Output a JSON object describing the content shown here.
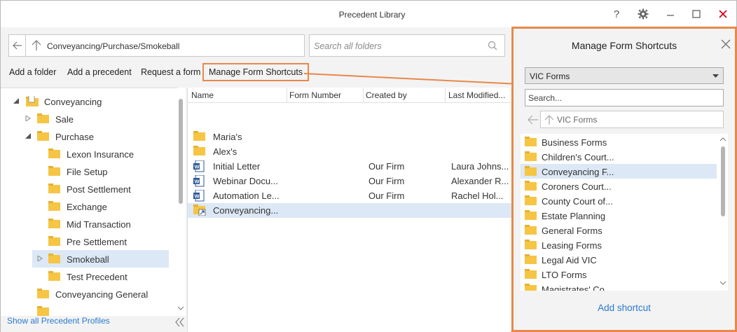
{
  "window": {
    "title": "Precedent Library",
    "help_icon": "question-icon",
    "settings_icon": "gear-icon",
    "minimize_icon": "minimize-icon",
    "maximize_icon": "maximize-icon",
    "close_icon": "close-icon",
    "close_color": "#d0021b"
  },
  "nav": {
    "path": "Conveyancing/Purchase/Smokeball",
    "search_placeholder": "Search all folders"
  },
  "actions": {
    "add_folder": "Add a folder",
    "add_precedent": "Add a precedent",
    "request_form": "Request a form",
    "manage_shortcuts": "Manage Form Shortcuts"
  },
  "tree": {
    "items": [
      {
        "label": "Conveyancing",
        "expanded": true,
        "icon": "document-folder-icon"
      },
      {
        "label": "Sale",
        "expanded": false
      },
      {
        "label": "Purchase",
        "expanded": true
      },
      {
        "label": "Lexon Insurance"
      },
      {
        "label": "File Setup"
      },
      {
        "label": "Post Settlement"
      },
      {
        "label": "Exchange"
      },
      {
        "label": "Mid Transaction"
      },
      {
        "label": "Pre Settlement"
      },
      {
        "label": "Smokeball",
        "expanded": false,
        "selected": true
      },
      {
        "label": "Test Precedent"
      },
      {
        "label": "Conveyancing General"
      }
    ]
  },
  "footer": {
    "show_all": "Show all Precedent Profiles"
  },
  "list": {
    "columns": [
      "Name",
      "Form Number",
      "Created by",
      "Last Modified..."
    ],
    "rows": [
      {
        "name": "Maria's",
        "form_number": "",
        "created_by": "",
        "last_modified": "",
        "icon": "folder-icon"
      },
      {
        "name": "Alex's",
        "form_number": "",
        "created_by": "",
        "last_modified": "",
        "icon": "folder-icon"
      },
      {
        "name": "Initial Letter",
        "form_number": "",
        "created_by": "Our Firm",
        "last_modified": "Laura Johns...",
        "icon": "word-doc-icon"
      },
      {
        "name": "Webinar Docu...",
        "form_number": "",
        "created_by": "Our Firm",
        "last_modified": "Alexander R...",
        "icon": "word-doc-icon"
      },
      {
        "name": "Automation Le...",
        "form_number": "",
        "created_by": "Our Firm",
        "last_modified": "Rachel Hol...",
        "icon": "word-doc-icon"
      },
      {
        "name": "Conveyancing...",
        "form_number": "",
        "created_by": "",
        "last_modified": "",
        "icon": "shortcut-folder-icon",
        "selected": true
      }
    ]
  },
  "shortcuts_panel": {
    "title": "Manage Form Shortcuts",
    "form_set": "VIC Forms",
    "search_placeholder": "Search...",
    "path": "VIC Forms",
    "items": [
      {
        "label": "Business Forms"
      },
      {
        "label": "Children's Court..."
      },
      {
        "label": "Conveyancing F...",
        "selected": true
      },
      {
        "label": "Coroners Court..."
      },
      {
        "label": "County Court of..."
      },
      {
        "label": "Estate Planning"
      },
      {
        "label": "General Forms"
      },
      {
        "label": "Leasing Forms"
      },
      {
        "label": "Legal Aid VIC"
      },
      {
        "label": "LTO Forms"
      },
      {
        "label": "Magistrates' Co..."
      }
    ],
    "add_shortcut": "Add shortcut"
  },
  "colors": {
    "accent_orange": "#e8884a",
    "link_blue": "#2b79d0",
    "selection": "#dce8f5",
    "folder_yellow": "#f6c544"
  }
}
